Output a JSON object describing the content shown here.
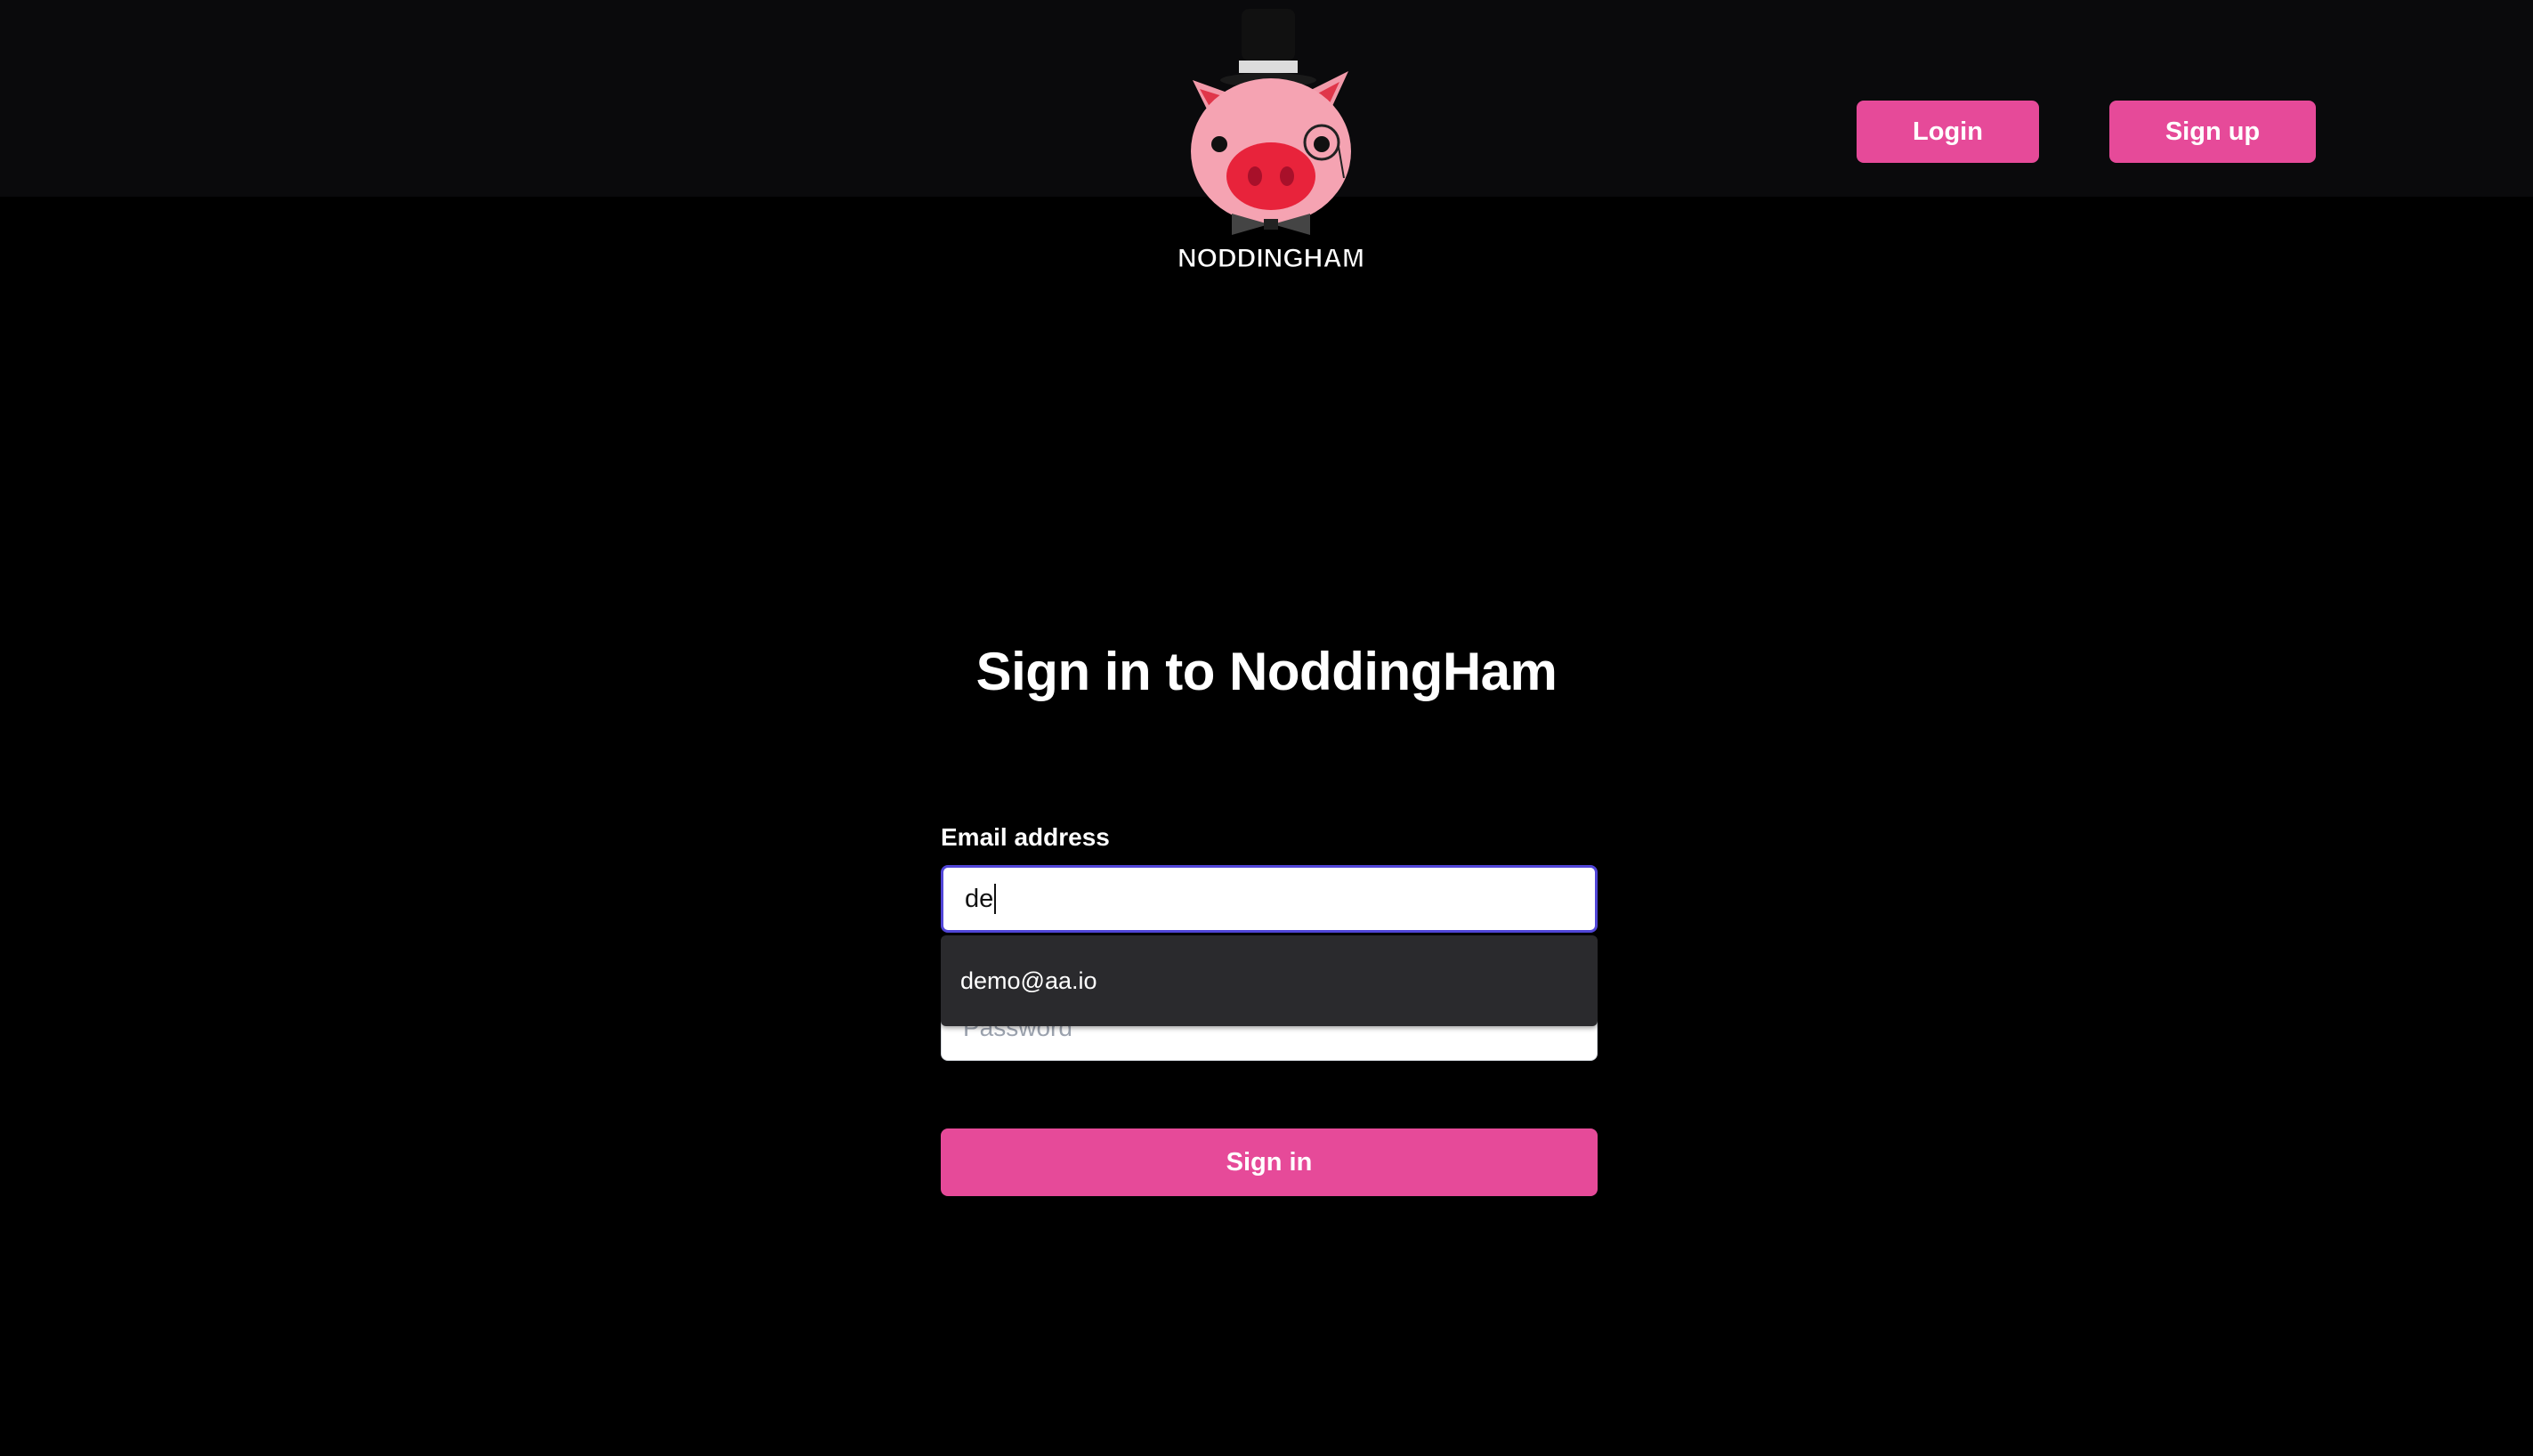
{
  "header": {
    "logo_text": "NODDINGHAM",
    "login_label": "Login",
    "signup_label": "Sign up"
  },
  "main": {
    "title": "Sign in to NoddingHam",
    "email_label": "Email address",
    "email_value": "de",
    "autocomplete_suggestion": "demo@aa.io",
    "password_placeholder": "Password",
    "signin_label": "Sign in"
  },
  "colors": {
    "accent": "#e64a99",
    "topbar": "#0a0a0c",
    "background": "#000000",
    "focus_border": "#5146d8",
    "autocomplete_bg": "#2a2a2d"
  },
  "icons": {
    "logo": "top-hat-pig-mascot-icon"
  }
}
